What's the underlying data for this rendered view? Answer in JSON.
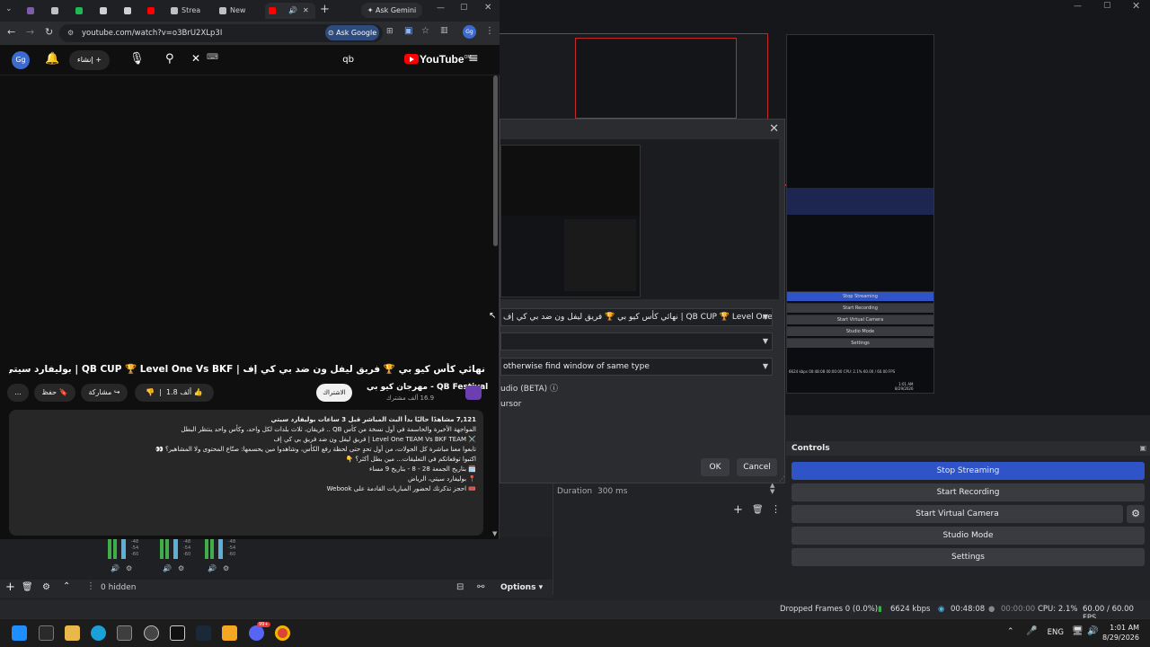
{
  "chrome": {
    "tabs": [
      {
        "label": "",
        "color": "#7b5ea7"
      },
      {
        "label": "",
        "color": "#c0c0c0"
      },
      {
        "label": "",
        "color": "#1db954"
      },
      {
        "label": "",
        "color": "#d0d0d0"
      },
      {
        "label": "",
        "color": "#d0d0d0"
      },
      {
        "label": "",
        "color": "#ff0000"
      },
      {
        "label": "Strea",
        "color": "#c0c0c0"
      },
      {
        "label": "New",
        "color": "#c0c0c0"
      },
      {
        "label": "",
        "color": "#ff0000"
      }
    ],
    "ask_gemini": "Ask Gemini",
    "url": "youtube.com/watch?v=o3BrU2XLp3I",
    "ask_google": "Ask Google",
    "profile": "Gg"
  },
  "youtube": {
    "profile": "Gg",
    "create_label": "إنشاء",
    "search_query": "qb",
    "logo": "YouTube",
    "logo_sup": "OM",
    "video_title": "نهائي كأس كيو بي 🏆 فريق ليفل ون ضد بي كي إف | QB CUP 🏆 Level One Vs BKF | بوليفارد سيتي الرياض",
    "channel_name": "مهرجان كيو بي - QB Festival",
    "channel_subs": "16.9 ألف مشترك",
    "subscribe": "الاشتراك",
    "likes": "1.8 ألف",
    "share": "مشاركة",
    "save": "حفظ",
    "more": "...",
    "description": [
      "7,121 مشاهدًا حاليًا  بدأ البث المباشر قبل 3 ساعات  بوليفارد سيتي",
      "المواجهة الأخيرة والحاسمة في أول نسخة من كأس QB .. فريقان، ثلاث بلدات لكل واحد، وكأس واحد ينتظر البطل",
      "⚔️ Level One TEAM Vs BKF TEAM | فريق ليفل ون ضد فريق بي كي إف",
      "",
      "تابعوا معنا مباشرة كل الجولات، من أول تحدٍ حتى لحظة رفع الكأس، وشاهدوا مين يحسمها: صنّاع المحتوى ولا المشاهير؟ 👀",
      "",
      "اكتبوا توقعاتكم في التعليقات... مين بطل أكثر؟ 👇",
      "",
      "🗓️ بتاريخ الجمعة 28 - 8 - بتاريخ 9 مساء",
      "📍 بوليفارد سيتي، الرياض",
      "🎟️ احجز تذكرتك لحضور المباريات القادمة على Webook"
    ]
  },
  "dialog": {
    "window_select": "نهائي كأس كيو بي 🏆 فريق ليفل ون ضد بي كي إف | QB CUP 🏆 Level One Vs BKF |",
    "capture_select": "",
    "priority_select": "otherwise find window of same type",
    "audio_label": "udio (BETA)",
    "cursor_label": "ursor",
    "ok": "OK",
    "cancel": "Cancel"
  },
  "obs": {
    "controls_title": "Controls",
    "stop_streaming": "Stop Streaming",
    "start_recording": "Start Recording",
    "start_virtual_camera": "Start Virtual Camera",
    "studio_mode": "Studio Mode",
    "settings": "Settings",
    "duration_label": "Duration",
    "duration_value": "300 ms",
    "hidden_count": "0 hidden",
    "options": "Options",
    "meter_labels": [
      "-48",
      "-54",
      "-60"
    ],
    "status": {
      "dropped_frames": "Dropped Frames 0 (0.0%)",
      "bitrate": "6624 kbps",
      "stream_time": "00:48:08",
      "rec_time": "00:00:00",
      "cpu": "CPU: 2.1%",
      "fps": "60.00 / 60.00 FPS"
    },
    "mini": {
      "stop_streaming": "Stop Streaming",
      "start_recording": "Start Recording",
      "start_virtual_camera": "Start Virtual Camera",
      "studio_mode": "Studio Mode",
      "settings": "Settings",
      "status": "6624 kbps   00:48:08   00:00:00   CPU: 2.1%   60.00 / 60.00 FPS",
      "time": "1:01 AM",
      "date": "8/29/2026"
    }
  },
  "taskbar": {
    "lang": "ENG",
    "time": "1:01 AM",
    "date": "8/29/2026",
    "badge": "99+"
  }
}
